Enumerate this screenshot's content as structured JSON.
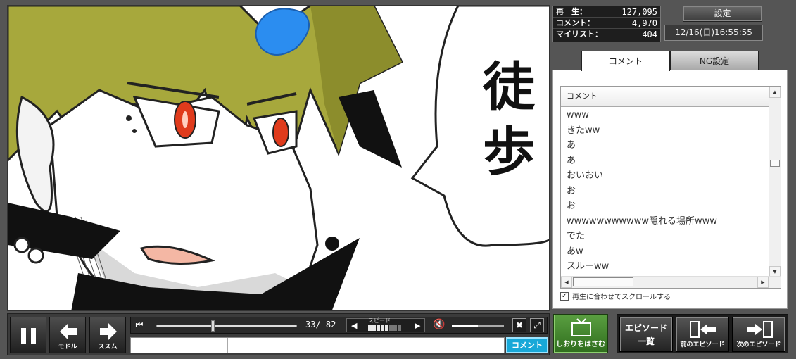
{
  "stats": {
    "play_label": "再　生：",
    "play_count": "127,095",
    "comment_label": "コメント：",
    "comment_count": "4,970",
    "mylist_label": "マイリスト：",
    "mylist_count": "404"
  },
  "header": {
    "settings_label": "設定",
    "datetime": "12/16(日)16:55:55"
  },
  "tabs": {
    "comment": "コメント",
    "ng": "NG設定"
  },
  "comment_list": {
    "header": "コメント",
    "items": [
      "www",
      "きたww",
      "あ",
      "あ",
      "おいおい",
      "お",
      "お",
      "wwwwwwwwwww隠れる場所www",
      "でた",
      "あw",
      "スルーww"
    ],
    "autoscroll_label": "再生に合わせてスクロールする",
    "autoscroll_checked": true
  },
  "video": {
    "bubble_char1": "徒",
    "bubble_char2": "歩"
  },
  "controls": {
    "back_label": "モドル",
    "forward_label": "ススム",
    "time": "33/ 82",
    "speed_label": "スピード",
    "comment_submit": "コメント",
    "progress_fraction": 0.4,
    "volume_fraction": 0.5
  },
  "episode": {
    "bookmark_label": "しおりをはさむ",
    "list_label_line1": "エピソード",
    "list_label_line2": "一覧",
    "prev_label": "前のエピソード",
    "next_label": "次のエピソード"
  },
  "colors": {
    "hair": "#a7a83c",
    "eye": "#e03b1c",
    "gem": "#2b8df0",
    "submit": "#18a8d8",
    "bookmark": "#4f8d36"
  }
}
